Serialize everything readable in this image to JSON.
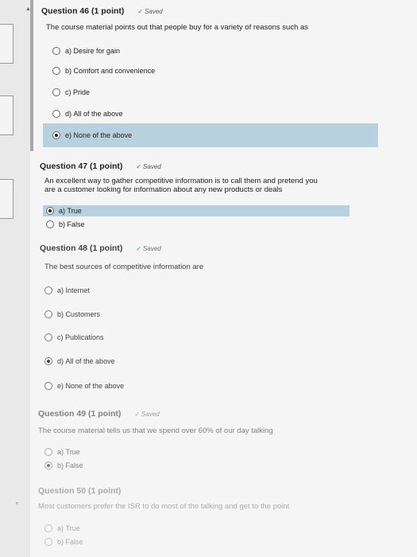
{
  "questions": [
    {
      "header": "Question 46 (1 point)",
      "saved": "Saved",
      "text": "The course material points out that people buy for a variety of reasons such as",
      "options": [
        {
          "prefix": "a)",
          "label": "Desire for gain",
          "selected": false
        },
        {
          "prefix": "b)",
          "label": "Comfort and convenience",
          "selected": false
        },
        {
          "prefix": "c)",
          "label": "Pride",
          "selected": false
        },
        {
          "prefix": "d)",
          "label": "All of the above",
          "selected": false
        },
        {
          "prefix": "e)",
          "label": "None of the above",
          "selected": true
        }
      ]
    },
    {
      "header": "Question 47 (1 point)",
      "saved": "Saved",
      "text_line1": "An excellent way to gather competitive information is to call them and pretend you",
      "text_line2": "are a customer looking for information about any new products or deals",
      "options": [
        {
          "prefix": "a)",
          "label": "True",
          "selected": true
        },
        {
          "prefix": "b)",
          "label": "False",
          "selected": false
        }
      ]
    },
    {
      "header": "Question 48 (1 point)",
      "saved": "Saved",
      "text": "The best sources of competitive information are",
      "options": [
        {
          "prefix": "a)",
          "label": "Internet",
          "selected": false
        },
        {
          "prefix": "b)",
          "label": "Customers",
          "selected": false
        },
        {
          "prefix": "c)",
          "label": "Publications",
          "selected": false
        },
        {
          "prefix": "d)",
          "label": "All of the above",
          "selected": true
        },
        {
          "prefix": "e)",
          "label": "None of the above",
          "selected": false
        }
      ]
    },
    {
      "header": "Question 49 (1 point)",
      "saved": "Saved",
      "text": "The course material tells us that we spend over 60% of our day talking",
      "options": [
        {
          "prefix": "a)",
          "label": "True",
          "selected": false
        },
        {
          "prefix": "b)",
          "label": "False",
          "selected": true
        }
      ]
    },
    {
      "header": "Question 50 (1 point)",
      "text": "Most customers prefer the ISR to do most of the talking and get to the point",
      "options": [
        {
          "prefix": "a)",
          "label": "True",
          "selected": false
        },
        {
          "prefix": "b)",
          "label": "False",
          "selected": false
        }
      ]
    }
  ],
  "colors": {
    "highlight": "#b7d1de",
    "saved_check": "#2e7d32"
  }
}
